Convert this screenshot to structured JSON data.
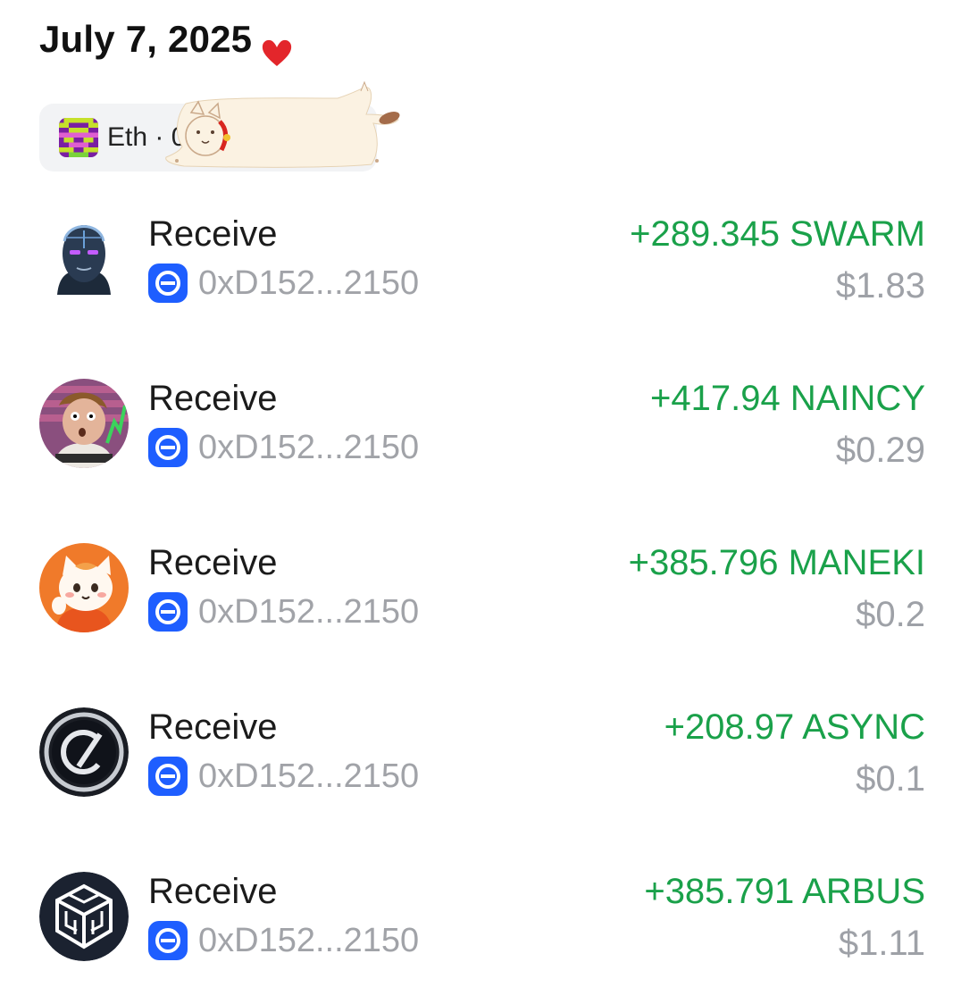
{
  "header": {
    "date": "July 7, 2025"
  },
  "wallet_chip": {
    "label": "Eth · 0"
  },
  "transactions": [
    {
      "type": "Receive",
      "address": "0xD152...2150",
      "amount": "+289.345 SWARM",
      "usd": "$1.83",
      "token_icon": "swarm-icon"
    },
    {
      "type": "Receive",
      "address": "0xD152...2150",
      "amount": "+417.94 NAINCY",
      "usd": "$0.29",
      "token_icon": "naincy-icon"
    },
    {
      "type": "Receive",
      "address": "0xD152...2150",
      "amount": "+385.796 MANEKI",
      "usd": "$0.2",
      "token_icon": "maneki-icon"
    },
    {
      "type": "Receive",
      "address": "0xD152...2150",
      "amount": "+208.97 ASYNC",
      "usd": "$0.1",
      "token_icon": "async-icon"
    },
    {
      "type": "Receive",
      "address": "0xD152...2150",
      "amount": "+385.791 ARBUS",
      "usd": "$1.11",
      "token_icon": "arbus-icon"
    }
  ],
  "colors": {
    "positive_amount": "#1aa14a",
    "muted_text": "#9ea1a7",
    "address_badge": "#1e5eff",
    "heart": "#e3262b"
  }
}
